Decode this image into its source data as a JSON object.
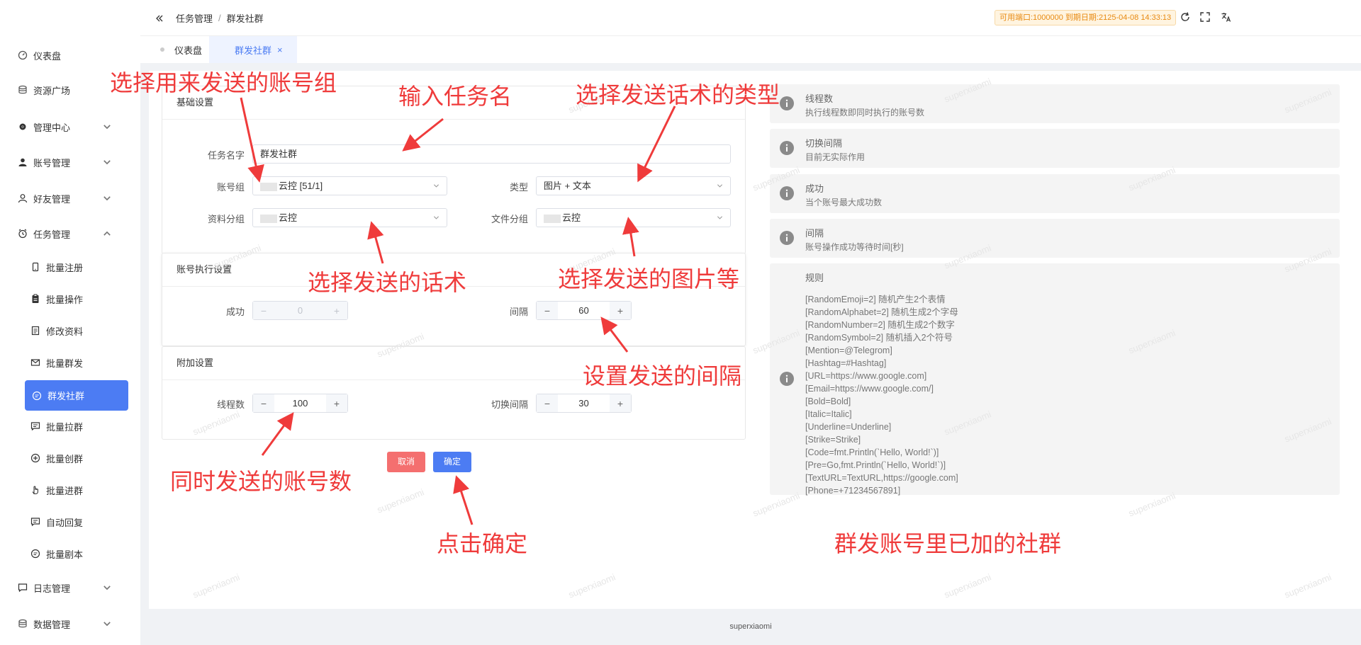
{
  "sidebar": {
    "items": [
      {
        "label": "仪表盘"
      },
      {
        "label": "资源广场"
      },
      {
        "label": "管理中心"
      },
      {
        "label": "账号管理"
      },
      {
        "label": "好友管理"
      },
      {
        "label": "任务管理"
      },
      {
        "label": "日志管理"
      },
      {
        "label": "数据管理"
      }
    ],
    "task_sub": [
      {
        "label": "批量注册"
      },
      {
        "label": "批量操作"
      },
      {
        "label": "修改资料"
      },
      {
        "label": "批量群发"
      },
      {
        "label": "群发社群"
      },
      {
        "label": "批量拉群"
      },
      {
        "label": "批量创群"
      },
      {
        "label": "批量进群"
      },
      {
        "label": "自动回复"
      },
      {
        "label": "批量剧本"
      }
    ]
  },
  "header": {
    "breadcrumb": [
      "任务管理",
      "群发社群"
    ],
    "breadcrumb_sep": "/",
    "expiry": "可用端口:1000000 到期日期:2125-04-08 14:33:13"
  },
  "tabs": [
    {
      "label": "仪表盘"
    },
    {
      "label": "群发社群",
      "close": "×"
    }
  ],
  "form": {
    "basic": {
      "title": "基础设置",
      "task_name_label": "任务名字",
      "task_name_value": "群发社群",
      "account_group_label": "账号组",
      "account_group_value": "云控 [51/1]",
      "type_label": "类型",
      "type_value": "图片 + 文本",
      "material_group_label": "资料分组",
      "material_group_value": "云控",
      "file_group_label": "文件分组",
      "file_group_value": "云控"
    },
    "exec": {
      "title": "账号执行设置",
      "success_label": "成功",
      "success_value": "0",
      "interval_label": "间隔",
      "interval_value": "60"
    },
    "extra": {
      "title": "附加设置",
      "threads_label": "线程数",
      "threads_value": "100",
      "switch_label": "切换间隔",
      "switch_value": "30"
    },
    "stepper_minus": "−",
    "stepper_plus": "+",
    "cancel_label": "取消",
    "ok_label": "确定"
  },
  "help": [
    {
      "title": "线程数",
      "desc": "执行线程数即同时执行的账号数"
    },
    {
      "title": "切换间隔",
      "desc": "目前无实际作用"
    },
    {
      "title": "成功",
      "desc": "当个账号最大成功数"
    },
    {
      "title": "间隔",
      "desc": "账号操作成功等待时间[秒]"
    }
  ],
  "rules": {
    "title": "规则",
    "lines": [
      "[RandomEmoji=2] 随机产生2个表情",
      "[RandomAlphabet=2] 随机生成2个字母",
      "[RandomNumber=2] 随机生成2个数字",
      "[RandomSymbol=2] 随机插入2个符号",
      "[Mention=@Telegrom]",
      "[Hashtag=#Hashtag]",
      "[URL=https://www.google.com]",
      "[Email=https://www.google.com/]",
      "[Bold=Bold]",
      "[Italic=Italic]",
      "[Underline=Underline]",
      "[Strike=Strike]",
      "[Code=fmt.Println(`Hello, World!`)]",
      "[Pre=Go,fmt.Println(`Hello, World!`)]",
      "[TextURL=TextURL,https://google.com]",
      "[Phone=+71234567891]"
    ]
  },
  "annotations": {
    "select_account_group": "选择用来发送的账号组",
    "enter_task_name": "输入任务名",
    "select_type": "选择发送话术的类型",
    "select_script": "选择发送的话术",
    "select_images": "选择发送的图片等",
    "set_interval": "设置发送的间隔",
    "concurrent_accounts": "同时发送的账号数",
    "click_ok": "点击确定",
    "group_note": "群发账号里已加的社群"
  },
  "watermark": "superxiaomi",
  "footer": {
    "text": "superxiaomi"
  },
  "colors": {
    "accent": "#4c7cf3",
    "danger": "#f46f6f",
    "annotation": "#ef3b3b",
    "expiry": "#e88a12"
  }
}
